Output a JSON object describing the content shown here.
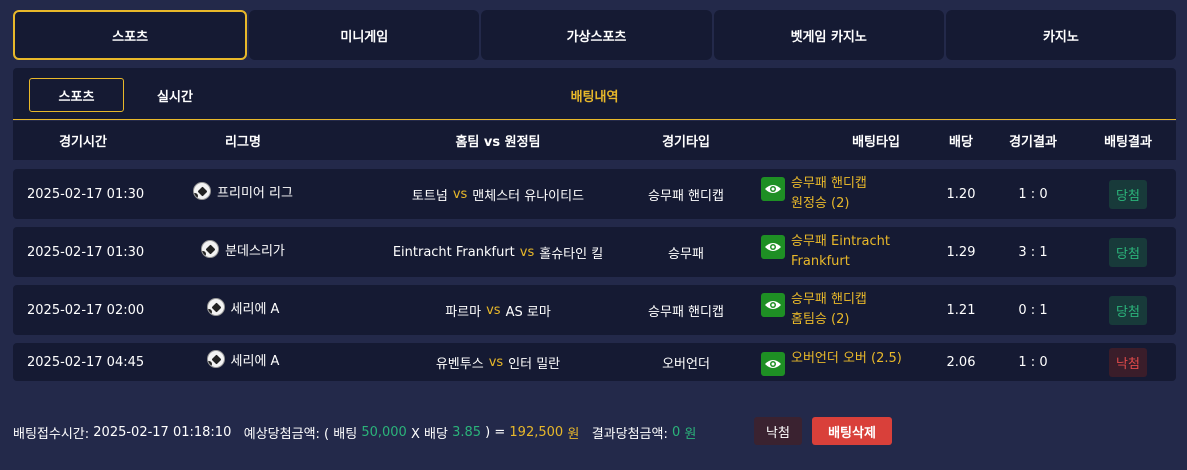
{
  "top_tabs": [
    "스포츠",
    "미니게임",
    "가상스포츠",
    "벳게임 카지노",
    "카지노"
  ],
  "sub_tabs": [
    "스포츠",
    "실시간"
  ],
  "history_label": "배팅내역",
  "columns": [
    "경기시간",
    "리그명",
    "홈팀 vs 원정팀",
    "경기타입",
    "배팅타입",
    "배당",
    "경기결과",
    "배팅결과"
  ],
  "vs_label": "vs",
  "rows": [
    {
      "time": "2025-02-17 01:30",
      "league": "프리미어 리그",
      "home": "토트넘",
      "away": "맨체스터 유나이티드",
      "game_type": "승무패 핸디캡",
      "bet_type_1": "승무패 핸디캡",
      "bet_type_2": "원정승 (2)",
      "odds": "1.20",
      "score": "1 : 0",
      "result": "당첨",
      "result_status": "win"
    },
    {
      "time": "2025-02-17 01:30",
      "league": "분데스리가",
      "home": "Eintracht Frankfurt",
      "away": "홀슈타인 킬",
      "game_type": "승무패",
      "bet_type_1": "승무패 Eintracht",
      "bet_type_2": "Frankfurt",
      "odds": "1.29",
      "score": "3 : 1",
      "result": "당첨",
      "result_status": "win"
    },
    {
      "time": "2025-02-17 02:00",
      "league": "세리에 A",
      "home": "파르마",
      "away": "AS 로마",
      "game_type": "승무패 핸디캡",
      "bet_type_1": "승무패 핸디캡",
      "bet_type_2": "홈팀승 (2)",
      "odds": "1.21",
      "score": "0 : 1",
      "result": "당첨",
      "result_status": "win"
    },
    {
      "time": "2025-02-17 04:45",
      "league": "세리에 A",
      "home": "유벤투스",
      "away": "인터 밀란",
      "game_type": "오버언더",
      "bet_type_1": "오버언더 오버 (2.5)",
      "bet_type_2": "",
      "odds": "2.06",
      "score": "1 : 0",
      "result": "낙첨",
      "result_status": "lose"
    }
  ],
  "footer": {
    "bet_time_label": "배팅접수시간:",
    "bet_time": "2025-02-17 01:18:10",
    "expected_label": "예상당첨금액: ( 배팅",
    "bet_amount": "50,000",
    "x_odds_label": "X 배당",
    "total_odds": "3.85",
    "equals": ") =",
    "expected_amount": "192,500",
    "won": "원",
    "result_label": "결과당첨금액:",
    "result_amount": "0",
    "won2": "원"
  },
  "buttons": {
    "lose": "낙첨",
    "delete": "배팅삭제"
  },
  "colors": {
    "accent": "#e8b82a",
    "win": "#2bb37a",
    "lose": "#e04a4a",
    "panel": "#151a33",
    "background": "#23294a"
  }
}
